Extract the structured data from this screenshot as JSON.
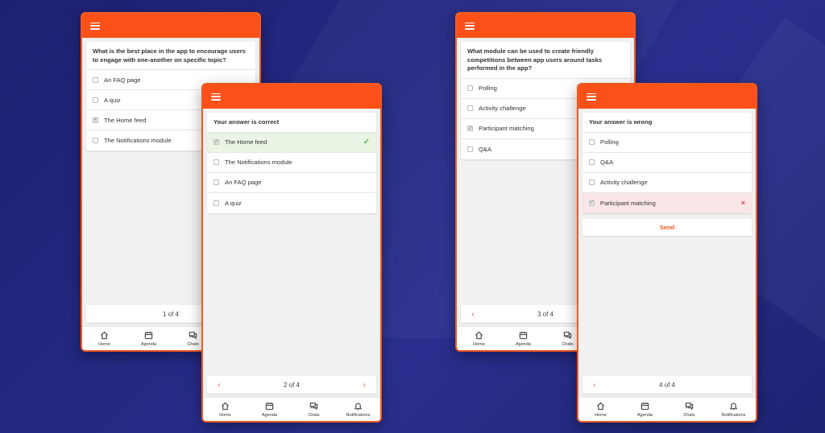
{
  "screen1": {
    "question": "What is the best place in the app to encourage users to engage with one-another on specific topic?",
    "options": [
      {
        "label": "An FAQ page",
        "checked": false
      },
      {
        "label": "A quiz",
        "checked": false
      },
      {
        "label": "The Home feed",
        "checked": true
      },
      {
        "label": "The Notifications module",
        "checked": false
      }
    ],
    "pager": "1 of 4"
  },
  "screen2": {
    "result": "Your answer is correct",
    "options": [
      {
        "label": "The Home feed",
        "checked": true,
        "status": "correct"
      },
      {
        "label": "The Notifications module",
        "checked": false
      },
      {
        "label": "An FAQ page",
        "checked": false
      },
      {
        "label": "A quiz",
        "checked": false
      }
    ],
    "pager": "2 of 4",
    "correct_mark": "✓"
  },
  "screen3": {
    "question": "What module can be used to create friendly competitions between app users around tasks performed in the app?",
    "options": [
      {
        "label": "Polling",
        "checked": false
      },
      {
        "label": "Activity challenge",
        "checked": false
      },
      {
        "label": "Participant matching",
        "checked": true
      },
      {
        "label": "Q&A",
        "checked": false
      }
    ],
    "pager": "3 of 4"
  },
  "screen4": {
    "result": "Your answer is wrong",
    "options": [
      {
        "label": "Polling",
        "checked": false
      },
      {
        "label": "Q&A",
        "checked": false
      },
      {
        "label": "Activity challenge",
        "checked": false
      },
      {
        "label": "Participant matching",
        "checked": true,
        "status": "wrong"
      }
    ],
    "send_label": "Send",
    "pager": "4 of 4",
    "wrong_mark": "×"
  },
  "nav": {
    "home": "Home",
    "agenda": "Agenda",
    "chats": "Chats",
    "notifications": "Notifications"
  },
  "arrows": {
    "prev": "‹",
    "next": "›"
  },
  "colors": {
    "accent": "#fb5118",
    "correct_bg": "#e9f4e4",
    "wrong_bg": "#fae6e6",
    "background": "#232781"
  }
}
